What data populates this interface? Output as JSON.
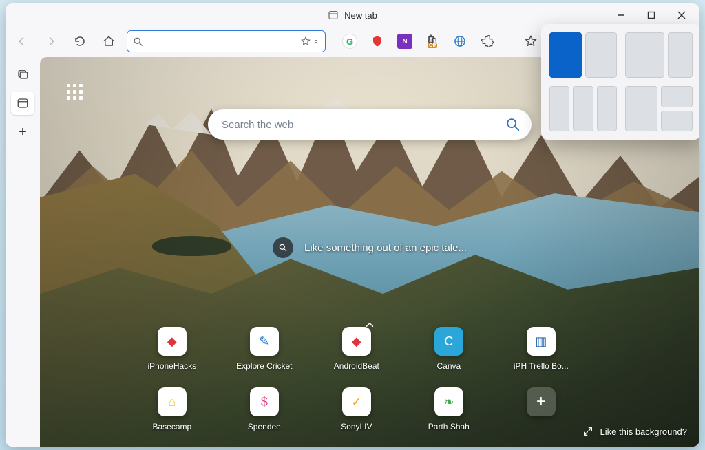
{
  "window": {
    "title": "New tab"
  },
  "toolbar": {
    "address_value": "",
    "address_placeholder": ""
  },
  "extensions": {
    "grammarly": "G",
    "onenote": "N",
    "honey_off": "Off"
  },
  "newtab": {
    "search_placeholder": "Search the web",
    "hint_text": "Like something out of an epic tale...",
    "like_bg_label": "Like this background?",
    "tiles_row1": [
      {
        "label": "iPhoneHacks",
        "icon_bg": "#ffffff",
        "icon_color": "#e0343c",
        "glyph": "◆"
      },
      {
        "label": "Explore Cricket",
        "icon_bg": "#ffffff",
        "icon_color": "#1f74c8",
        "glyph": "✎"
      },
      {
        "label": "AndroidBeat",
        "icon_bg": "#ffffff",
        "icon_color": "#e0343c",
        "glyph": "◆"
      },
      {
        "label": "Canva",
        "icon_bg": "#2aa6d8",
        "icon_color": "#ffffff",
        "glyph": "C"
      },
      {
        "label": "iPH Trello Bo...",
        "icon_bg": "#ffffff",
        "icon_color": "#2b6fb3",
        "glyph": "▥"
      }
    ],
    "tiles_row2": [
      {
        "label": "Basecamp",
        "icon_bg": "#ffffff",
        "icon_color": "#f4c430",
        "glyph": "⌂"
      },
      {
        "label": "Spendee",
        "icon_bg": "#ffffff",
        "icon_color": "#e04a8a",
        "glyph": "$"
      },
      {
        "label": "SonyLIV",
        "icon_bg": "#ffffff",
        "icon_color": "#f3a72e",
        "glyph": "✓"
      },
      {
        "label": "Parth Shah",
        "icon_bg": "#ffffff",
        "icon_color": "#39a845",
        "glyph": "❧"
      }
    ]
  }
}
